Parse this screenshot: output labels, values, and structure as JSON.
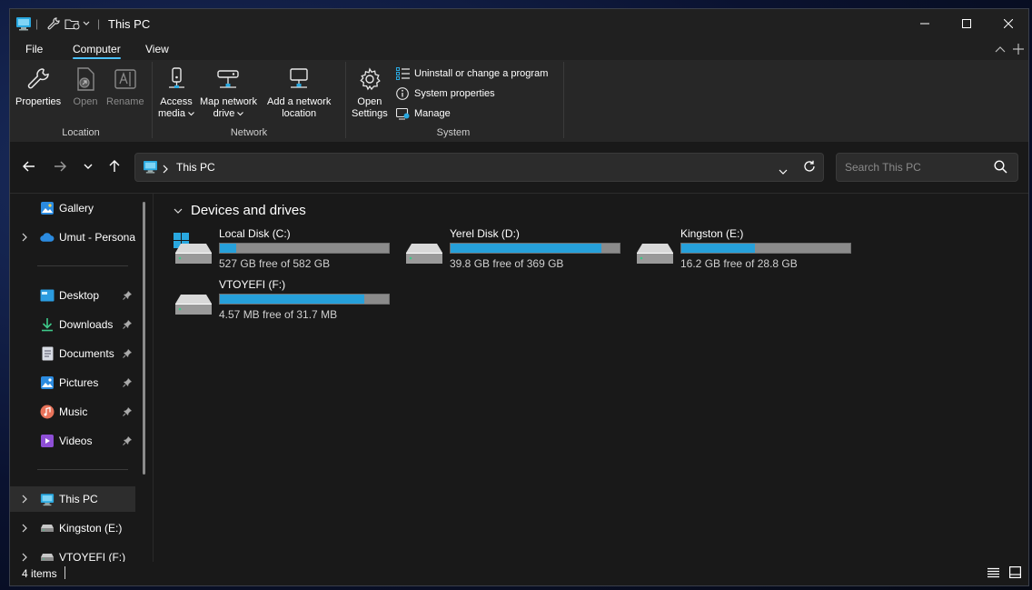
{
  "titlebar": {
    "title": "This PC"
  },
  "menu": {
    "file": "File",
    "computer": "Computer",
    "view": "View"
  },
  "ribbon": {
    "location": {
      "label": "Location",
      "properties": "Properties",
      "open": "Open",
      "rename": "Rename"
    },
    "network": {
      "label": "Network",
      "access_media_1": "Access",
      "access_media_2": "media",
      "map_drive_1": "Map network",
      "map_drive_2": "drive",
      "add_location_1": "Add a network",
      "add_location_2": "location"
    },
    "system": {
      "label": "System",
      "open_settings_1": "Open",
      "open_settings_2": "Settings",
      "uninstall": "Uninstall or change a program",
      "system_properties": "System properties",
      "manage": "Manage"
    }
  },
  "address": {
    "path": "This PC"
  },
  "search": {
    "placeholder": "Search This PC"
  },
  "sidebar": {
    "items": [
      {
        "label": "Gallery"
      },
      {
        "label": "Umut - Persona"
      },
      {
        "label": "Desktop"
      },
      {
        "label": "Downloads"
      },
      {
        "label": "Documents"
      },
      {
        "label": "Pictures"
      },
      {
        "label": "Music"
      },
      {
        "label": "Videos"
      },
      {
        "label": "This PC"
      },
      {
        "label": "Kingston (E:)"
      },
      {
        "label": "VTOYEFI (F:)"
      }
    ]
  },
  "content": {
    "section": "Devices and drives",
    "drives": [
      {
        "name": "Local Disk (C:)",
        "free": "527 GB free of 582 GB",
        "used_fraction": 0.095
      },
      {
        "name": "Yerel Disk (D:)",
        "free": "39.8 GB free of 369 GB",
        "used_fraction": 0.892
      },
      {
        "name": "Kingston (E:)",
        "free": "16.2 GB free of 28.8 GB",
        "used_fraction": 0.4375
      },
      {
        "name": "VTOYEFI (F:)",
        "free": "4.57 MB free of 31.7 MB",
        "used_fraction": 0.856
      }
    ]
  },
  "status": {
    "items": "4 items"
  },
  "colors": {
    "accent": "#4cc2ff",
    "drive_fill": "#26a0da",
    "drive_empty": "#8b8b8b"
  }
}
